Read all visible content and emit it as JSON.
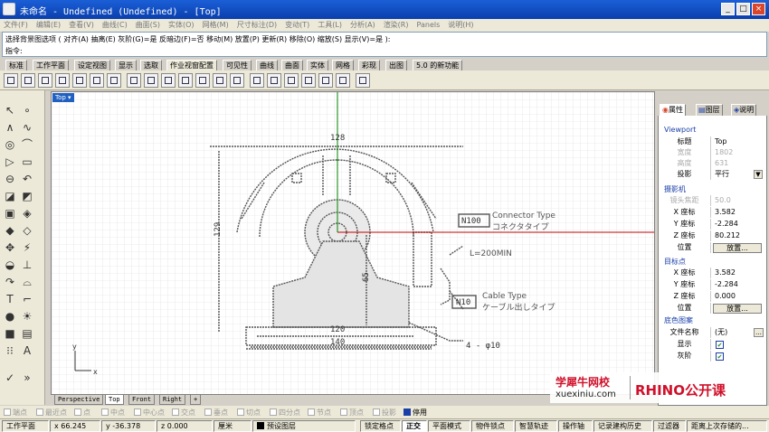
{
  "window": {
    "title": "未命名 - Undefined (Undefined) - [Top]",
    "buttons": [
      "_",
      "□",
      "×"
    ]
  },
  "menu": [
    "文件(F)",
    "编辑(E)",
    "查看(V)",
    "曲线(C)",
    "曲面(S)",
    "实体(O)",
    "网格(M)",
    "尺寸标注(D)",
    "变动(T)",
    "工具(L)",
    "分析(A)",
    "渲染(R)",
    "Panels",
    "说明(H)"
  ],
  "command": {
    "history": "选择背景图选项 ( 对齐(A) 抽离(E) 灰阶(G)=是 反暗边(F)=否 移动(M) 放置(P) 更新(R) 移除(O) 缩放(S) 显示(V)=是 ):",
    "prompt": "指令:"
  },
  "toolbar_tabs": [
    "标准",
    "工作平面",
    "设定视图",
    "显示",
    "选取",
    "作业视窗配置",
    "可见性",
    "曲线",
    "曲面",
    "实体",
    "网格",
    "彩现",
    "出图",
    "5.0 的新功能"
  ],
  "active_toolbar_tab": "作业视窗配置",
  "viewport": {
    "label": "Top",
    "axis_x": "x",
    "axis_y": "y",
    "tabs": [
      "Perspective",
      "Top",
      "Front",
      "Right"
    ],
    "active_tab": "Top",
    "add_tab": "+",
    "drawing": {
      "dim_top": "128",
      "dim_left": "129",
      "dim_mid": "65",
      "dim_bottom1": "120",
      "dim_bottom2": "140",
      "box_n100": "N100",
      "connector_type": "Connector Type",
      "connector_jp": "コネクタタイプ",
      "cable_length": "L=200MIN",
      "box_n10": "N10",
      "cable_type": "Cable Type",
      "cable_jp": "ケーブル出しタイプ",
      "hole_note": "4 - φ10"
    }
  },
  "panel": {
    "tabs": [
      "属性",
      "图层",
      "说明"
    ],
    "viewport_section": "Viewport",
    "viewport_rows": [
      {
        "key": "标题",
        "value": "Top",
        "disabled": false
      },
      {
        "key": "宽度",
        "value": "1802",
        "disabled": true
      },
      {
        "key": "高度",
        "value": "631",
        "disabled": true
      },
      {
        "key": "投影",
        "value": "平行",
        "disabled": false
      }
    ],
    "camera_section": "摄影机",
    "camera_rows": [
      {
        "key": "镜头焦距",
        "value": "50.0",
        "disabled": true
      },
      {
        "key": "X 座标",
        "value": "3.582",
        "disabled": false
      },
      {
        "key": "Y 座标",
        "value": "-2.284",
        "disabled": false
      },
      {
        "key": "Z 座标",
        "value": "80.212",
        "disabled": false
      }
    ],
    "position_label": "位置",
    "place_button": "放置...",
    "target_section": "目标点",
    "target_rows": [
      {
        "key": "X 座标",
        "value": "3.582",
        "disabled": false
      },
      {
        "key": "Y 座标",
        "value": "-2.284",
        "disabled": false
      },
      {
        "key": "Z 座标",
        "value": "0.000",
        "disabled": false
      }
    ],
    "background_section": "底色图案",
    "file_label": "文件名称",
    "file_value": "(无)",
    "file_button": "...",
    "show_label": "显示",
    "gray_label": "灰阶"
  },
  "osnap": [
    "端点",
    "最近点",
    "点",
    "中点",
    "中心点",
    "交点",
    "垂点",
    "切点",
    "四分点",
    "节点",
    "顶点",
    "投影",
    "停用"
  ],
  "status": {
    "cplane": "工作平面",
    "x": "x 66.245",
    "y": "y -36.378",
    "z": "z 0.000",
    "units": "厘米",
    "layer": "预设图层",
    "toggles": [
      "锁定格点",
      "正交",
      "平面模式",
      "物件锁点",
      "智慧轨迹",
      "操作轴",
      "记录建构历史",
      "过滤器",
      "距离上次存储的..."
    ],
    "active_toggle": "正交"
  },
  "watermark": {
    "brand": "学犀牛网校",
    "url": "xuexiniu.com",
    "course": "RHINO公开课"
  },
  "colors": {
    "title_bar": "#0a3fae",
    "accent_blue": "#1a3fa8",
    "axis_red": "#c00000",
    "axis_green": "#008000",
    "watermark_red": "#d0102a"
  }
}
